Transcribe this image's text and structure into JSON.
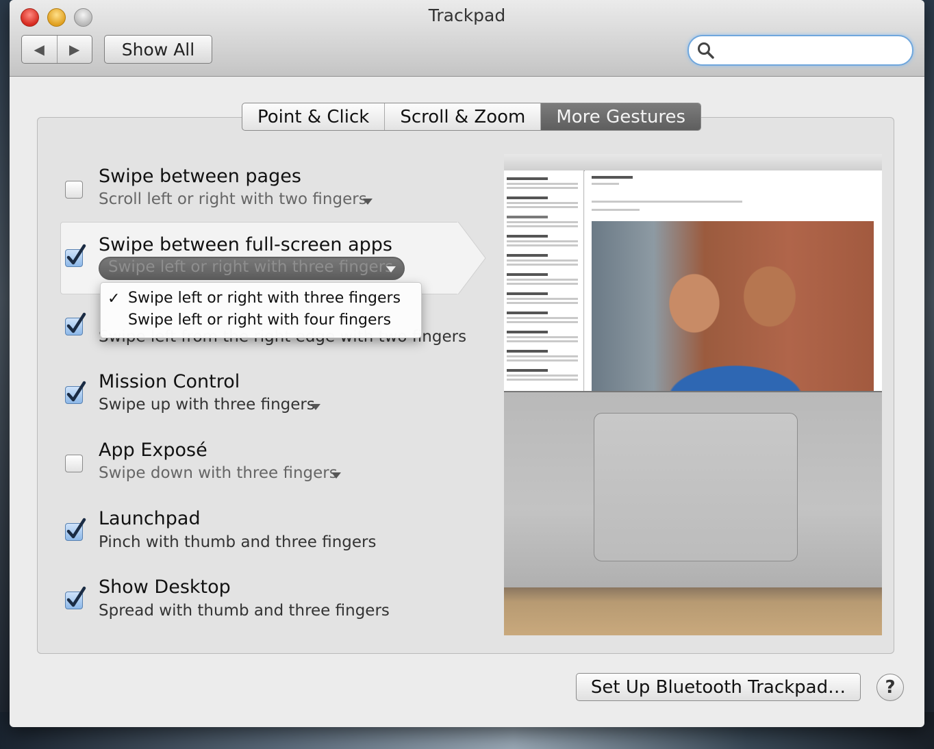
{
  "window": {
    "title": "Trackpad"
  },
  "toolbar": {
    "back_label": "◀",
    "forward_label": "▶",
    "show_all_label": "Show All",
    "search_value": "",
    "search_placeholder": ""
  },
  "tabs": [
    {
      "label": "Point & Click",
      "active": false
    },
    {
      "label": "Scroll & Zoom",
      "active": false
    },
    {
      "label": "More Gestures",
      "active": true
    }
  ],
  "gestures": [
    {
      "title": "Swipe between pages",
      "subtitle": "Scroll left or right with two fingers",
      "checked": false,
      "has_menu": true
    },
    {
      "title": "Swipe between full-screen apps",
      "subtitle": "Swipe left or right with three fingers",
      "checked": true,
      "has_menu": true,
      "selected": true
    },
    {
      "title": "",
      "subtitle": "Swipe left from the right edge with two fingers",
      "checked": true,
      "has_menu": false
    },
    {
      "title": "Mission Control",
      "subtitle": "Swipe up with three fingers",
      "checked": true,
      "has_menu": true
    },
    {
      "title": "App Exposé",
      "subtitle": "Swipe down with three fingers",
      "checked": false,
      "has_menu": true
    },
    {
      "title": "Launchpad",
      "subtitle": "Pinch with thumb and three fingers",
      "checked": true,
      "has_menu": false
    },
    {
      "title": "Show Desktop",
      "subtitle": "Spread with thumb and three fingers",
      "checked": true,
      "has_menu": false
    }
  ],
  "dropdown_menu": {
    "check_glyph": "✓",
    "items": [
      {
        "label": "Swipe left or right with three fingers",
        "checked": true
      },
      {
        "label": "Swipe left or right with four fingers",
        "checked": false
      }
    ]
  },
  "footer": {
    "bluetooth_label": "Set Up Bluetooth Trackpad…",
    "help_label": "?"
  },
  "colors": {
    "tab_active": "#6b6b6b",
    "checkbox_checked": "#8db8e8",
    "search_focus": "#6fa6dc"
  }
}
